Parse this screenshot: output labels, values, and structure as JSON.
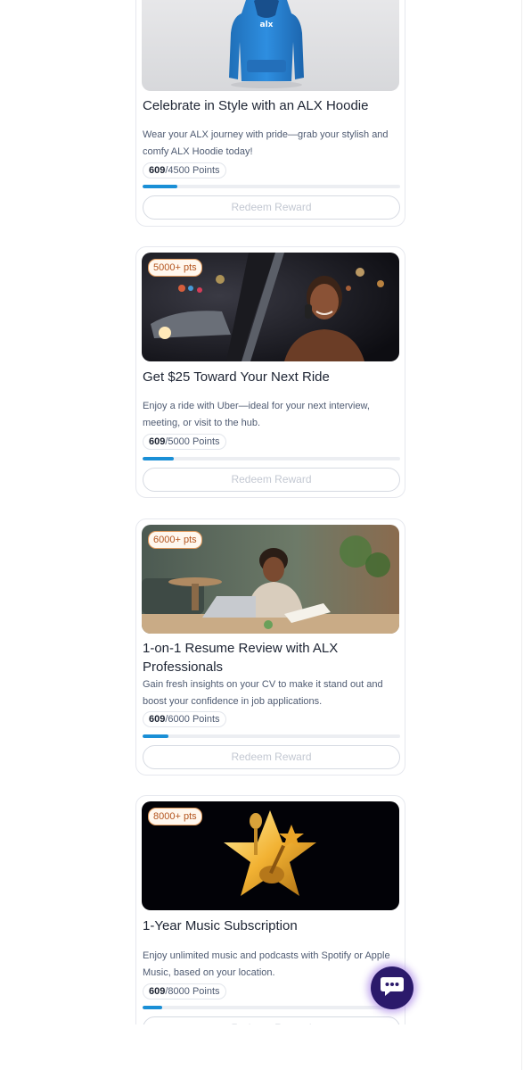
{
  "rewards": [
    {
      "badge": "",
      "title": "Celebrate in Style with an ALX Hoodie",
      "description": "Wear your ALX journey with pride—grab your stylish and comfy ALX Hoodie today!",
      "current_points": "609",
      "required_points": "/4500 Points",
      "progress": 0.135,
      "button_label": "Redeem Reward",
      "image_icon": "hoodie-image"
    },
    {
      "badge": "5000+ pts",
      "title": "Get $25 Toward Your Next Ride",
      "description": "Enjoy a ride with Uber—ideal for your next interview, meeting, or visit to the hub.",
      "current_points": "609",
      "required_points": "/5000 Points",
      "progress": 0.122,
      "button_label": "Redeem Reward",
      "image_icon": "ride-image"
    },
    {
      "badge": "6000+ pts",
      "title": "1-on-1 Resume Review with ALX Professionals",
      "description": "Gain fresh insights on your CV to make it stand out and boost your confidence in job applications.",
      "current_points": "609",
      "required_points": "/6000 Points",
      "progress": 0.102,
      "button_label": "Redeem Reward",
      "image_icon": "resume-review-image"
    },
    {
      "badge": "8000+ pts",
      "title": "1-Year Music Subscription",
      "description": "Enjoy unlimited music and podcasts with Spotify or Apple Music, based on your location.",
      "current_points": "609",
      "required_points": "/8000 Points",
      "progress": 0.076,
      "button_label": "Redeem Reward",
      "image_icon": "music-star-image"
    }
  ],
  "hoodie_logo": "alx",
  "chat": {
    "icon": "chat-icon"
  },
  "colors": {
    "accent": "#1a8fd6",
    "badge_text": "#b3541e",
    "chat_button": "#2b1a6b"
  }
}
